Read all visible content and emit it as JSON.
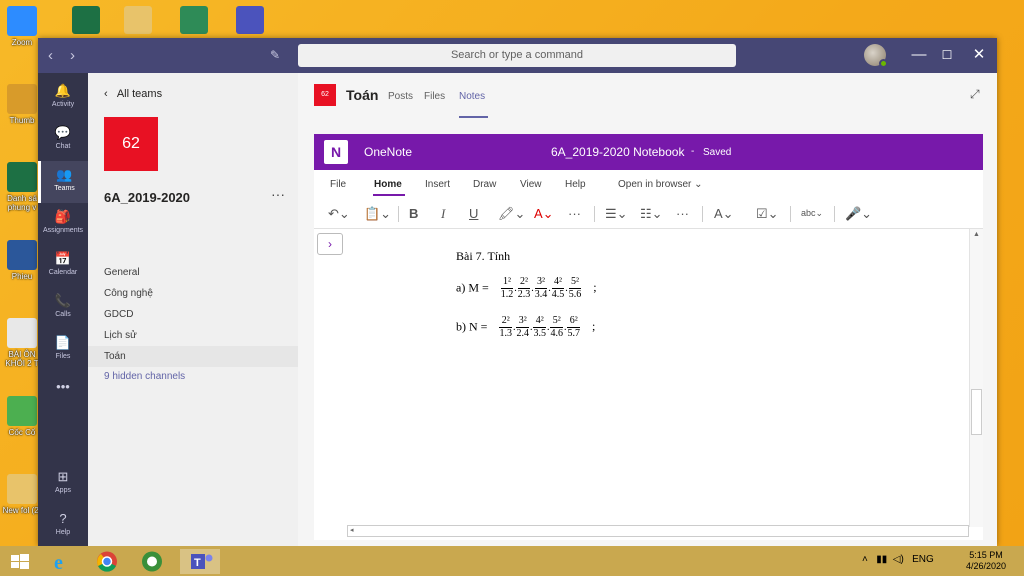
{
  "desktop": {
    "icons": [
      {
        "label": "Zoom",
        "color": "#2d8cff"
      },
      {
        "label": "Thumb",
        "color": "#d89b2a"
      },
      {
        "label": "Danh sá phung v",
        "color": "#1d7044"
      },
      {
        "label": "Phieu",
        "color": "#2b579a"
      },
      {
        "label": "BÀI ÔN KHỐI 2 T",
        "color": "#e8e8e8"
      },
      {
        "label": "Cốc Cố",
        "color": "#4caf50"
      },
      {
        "label": "New fol (2)",
        "color": "#e8c36a"
      }
    ]
  },
  "titlebar": {
    "back": "‹",
    "forward": "›",
    "search_placeholder": "Search or type a command"
  },
  "rail": [
    {
      "label": "Activity",
      "icon": "bell-icon",
      "glyph": "🔔"
    },
    {
      "label": "Chat",
      "icon": "chat-icon",
      "glyph": "💬"
    },
    {
      "label": "Teams",
      "icon": "teams-icon",
      "glyph": "👥"
    },
    {
      "label": "Assignments",
      "icon": "assignments-icon",
      "glyph": "🎒"
    },
    {
      "label": "Calendar",
      "icon": "calendar-icon",
      "glyph": "📅"
    },
    {
      "label": "Calls",
      "icon": "phone-icon",
      "glyph": "📞"
    },
    {
      "label": "Files",
      "icon": "file-icon",
      "glyph": "📄"
    },
    {
      "label": "",
      "icon": "more-icon",
      "glyph": "•••"
    },
    {
      "label": "Apps",
      "icon": "apps-icon",
      "glyph": "⊞"
    },
    {
      "label": "Help",
      "icon": "help-icon",
      "glyph": "?"
    }
  ],
  "team_panel": {
    "all_teams": "All teams",
    "team_tile": "62",
    "team_name": "6A_2019-2020",
    "more": "···",
    "channels": [
      "General",
      "Công nghệ",
      "GDCD",
      "Lịch sử",
      "Toán"
    ],
    "active_channel": "Toán",
    "hidden": "9 hidden channels"
  },
  "channel": {
    "tile": "62",
    "name": "Toán",
    "tabs": [
      "Posts",
      "Files",
      "Notes"
    ],
    "active_tab": "Notes"
  },
  "onenote": {
    "app": "OneNote",
    "notebook": "6A_2019-2020 Notebook",
    "dash": "-",
    "status": "Saved",
    "menu": [
      "File",
      "Home",
      "Insert",
      "Draw",
      "View",
      "Help",
      "Open in browser ⌄"
    ],
    "active_menu": "Home",
    "toolbar": {
      "undo": "↶⌄",
      "paste": "📋⌄",
      "bold": "B",
      "italic": "I",
      "underline": "U",
      "highlight": "🖍⌄",
      "font_color": "A⌄",
      "more1": "···",
      "bullets": "☰⌄",
      "numbering": "☷⌄",
      "more2": "···",
      "styles": "A⌄",
      "tags": "☑⌄",
      "spelling": "abc⌄",
      "dictate": "🎤⌄"
    },
    "nav_toggle": "›",
    "content": {
      "heading": "Bài 7. Tính",
      "line_a_prefix": "a) M =",
      "line_b_prefix": "b) N =",
      "terminator": ";",
      "fractions_a": [
        {
          "num": "1²",
          "den": "1.2"
        },
        {
          "num": "2²",
          "den": "2.3"
        },
        {
          "num": "3²",
          "den": "3.4"
        },
        {
          "num": "4²",
          "den": "4.5"
        },
        {
          "num": "5²",
          "den": "5.6"
        }
      ],
      "fractions_b": [
        {
          "num": "2²",
          "den": "1.3"
        },
        {
          "num": "3²",
          "den": "2.4"
        },
        {
          "num": "4²",
          "den": "3.5"
        },
        {
          "num": "5²",
          "den": "4.6"
        },
        {
          "num": "6²",
          "den": "5.7"
        }
      ]
    }
  },
  "taskbar": {
    "apps": [
      "windows-start-icon",
      "internet-explorer-icon",
      "chrome-icon",
      "coccoc-icon",
      "teams-icon"
    ],
    "active_app": "teams-icon",
    "tray_lang": "ENG",
    "time": "5:15 PM",
    "date": "4/26/2020"
  },
  "colors": {
    "teams_titlebar": "#464775",
    "teams_rail": "#33344a",
    "teams_accent": "#6264a7",
    "onenote_purple": "#7719aa",
    "team_tile": "#e81123"
  }
}
